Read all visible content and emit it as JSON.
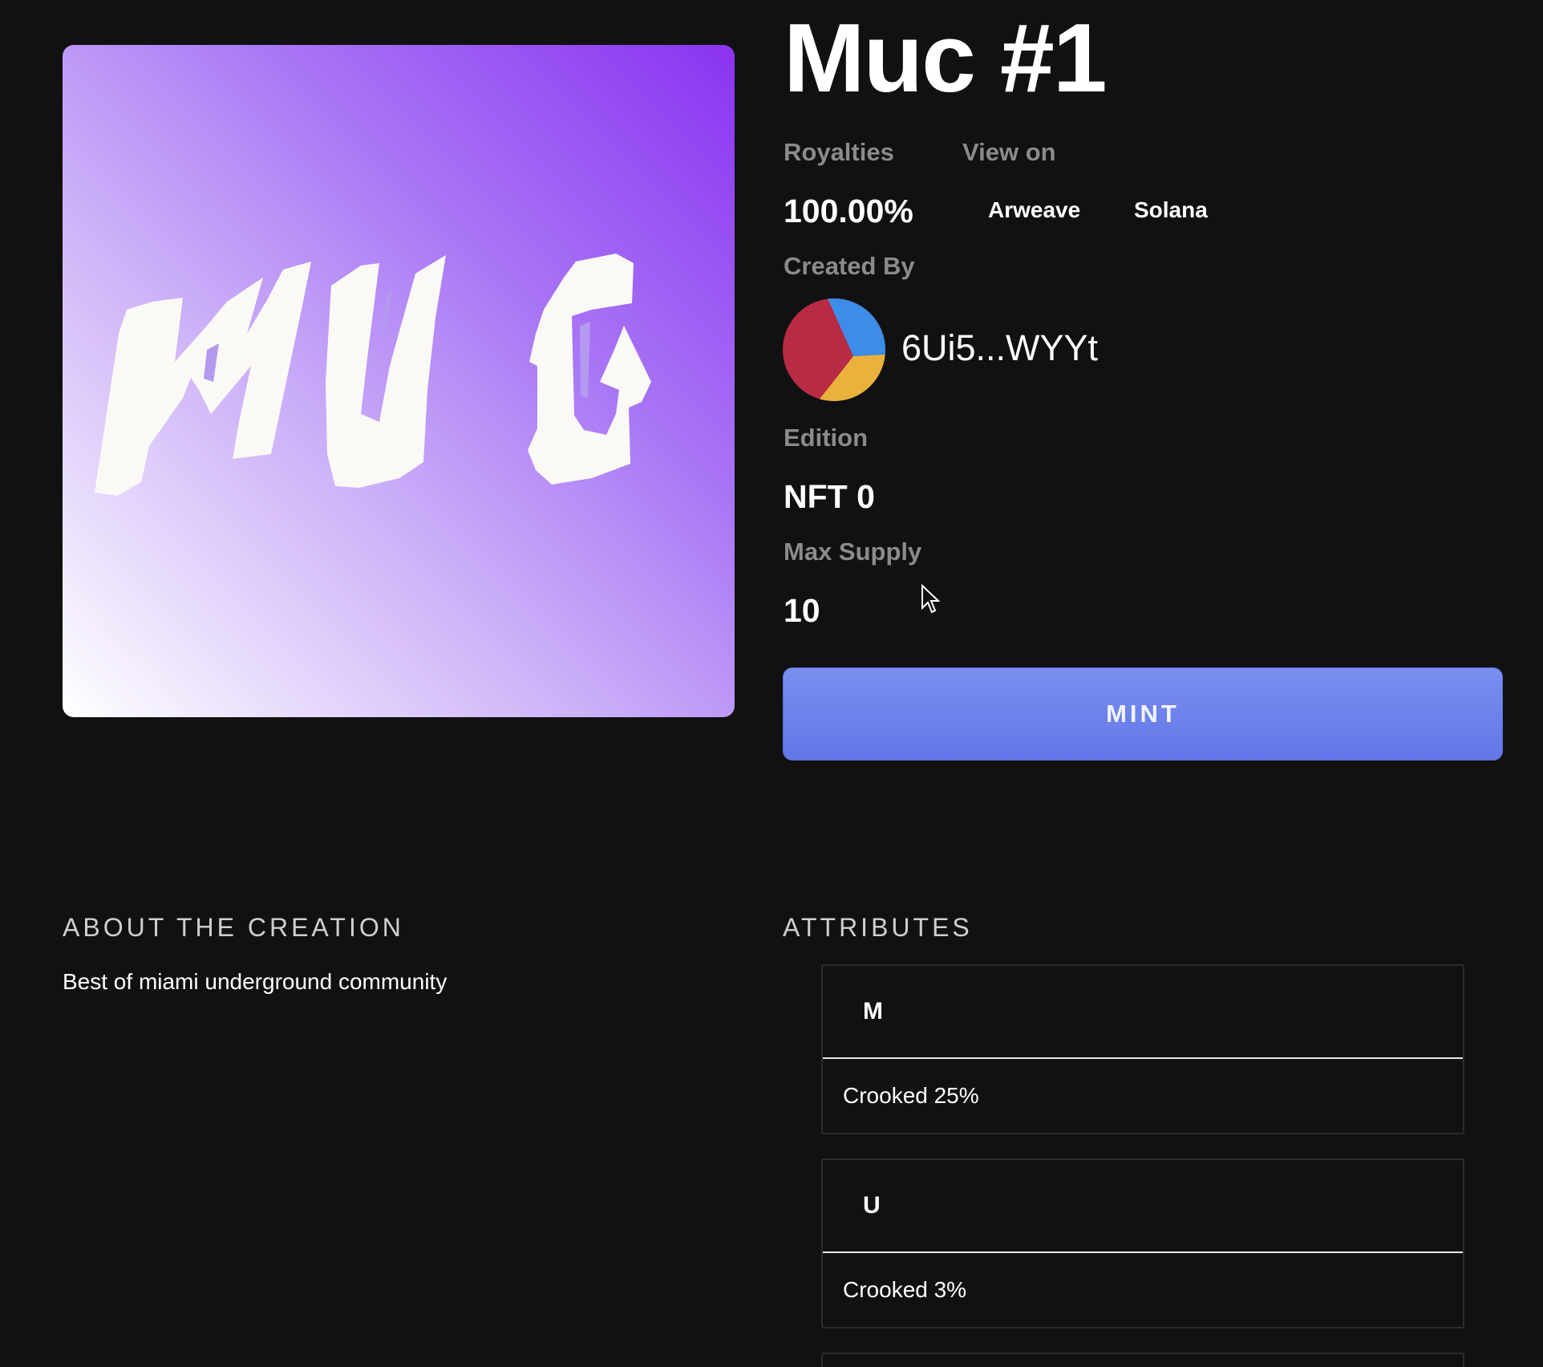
{
  "nft": {
    "title": "Muc #1",
    "image_alt": "MUG artwork",
    "image_text": "MUG"
  },
  "details": {
    "royalties_label": "Royalties",
    "royalties_value": "100.00%",
    "view_on_label": "View on",
    "view_on_links": [
      "Arweave",
      "Solana"
    ],
    "created_by_label": "Created By",
    "creator_address": "6Ui5...WYYt",
    "edition_label": "Edition",
    "edition_value": "NFT 0",
    "max_supply_label": "Max Supply",
    "max_supply_value": "10"
  },
  "actions": {
    "mint_label": "MINT"
  },
  "about": {
    "heading": "ABOUT THE CREATION",
    "description": "Best of miami underground community"
  },
  "attributes": {
    "heading": "ATTRIBUTES",
    "items": [
      {
        "trait": "M",
        "value": "Crooked 25%"
      },
      {
        "trait": "U",
        "value": "Crooked 3%"
      }
    ]
  },
  "colors": {
    "background": "#111111",
    "mint_button": "#6a7fec",
    "label_gray": "#8b8b8b",
    "art_gradient_dark": "#8a33f1",
    "avatar_colors": [
      "#3d8ce8",
      "#b72b44",
      "#e8b23d"
    ]
  }
}
